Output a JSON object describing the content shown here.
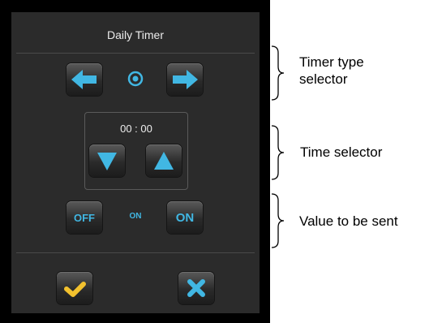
{
  "panel": {
    "title": "Daily Timer",
    "time_value": "00 : 00",
    "on_state_label": "ON"
  },
  "buttons": {
    "off_label": "OFF",
    "on_label": "ON"
  },
  "icons": {
    "prev_type": "arrow-left-icon",
    "next_type": "arrow-right-icon",
    "timer_type": "target-icon",
    "decrease": "triangle-down-icon",
    "increase": "triangle-up-icon",
    "confirm": "checkmark-icon",
    "cancel": "x-icon"
  },
  "colors": {
    "accent_blue": "#41b7e3",
    "confirm_yellow": "#f2c12e",
    "panel_bg": "#2b2b2b"
  },
  "annotations": {
    "timer_type_line1": "Timer type",
    "timer_type_line2": "selector",
    "time_selector": "Time selector",
    "value_to_send": "Value to be sent"
  }
}
